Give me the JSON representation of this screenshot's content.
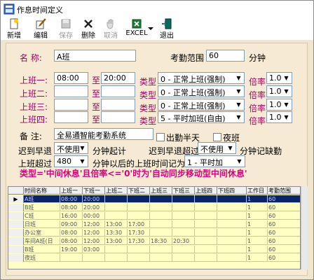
{
  "window": {
    "title": "作息时间定义"
  },
  "toolbar": {
    "new_label": "新增",
    "edit_label": "编辑",
    "save_label": "保存",
    "delete_label": "删除",
    "cancel_label": "取消",
    "excel_label": "EXCEL",
    "exit_label": "退出"
  },
  "form": {
    "name_label": "名  称:",
    "name_value": "A班",
    "range_label": "考勤范围",
    "range_value": "60",
    "range_unit": "分钟",
    "shift1_label": "上班一:",
    "shift2_label": "上班二:",
    "shift3_label": "上班三:",
    "shift4_label": "上班四:",
    "shift1_start": "08:00",
    "shift1_end": "20:00",
    "to_label": "至",
    "type_label": "类型",
    "rate_label": "倍率",
    "type1": "0 - 正常上班(强制)",
    "type2": "0 - 正常上班(强制)",
    "type3": "0 - 正常上班(强制)",
    "type4": "5 - 平时加班(自由)",
    "rate1": "1.0",
    "rate2": "1.0",
    "rate3": "1.0",
    "rate4": "1.0",
    "remark_label": "备  注:",
    "remark_value": "全易通智能考勤系统",
    "halfday_label": "出勤半天",
    "night_label": "夜班",
    "late_label": "迟到早退",
    "late_value": "不使用",
    "late_unit": "分钟起计",
    "late_over_label": "迟到早退超过",
    "late_over_value": "不使用",
    "late_over_unit": "分钟记缺勤",
    "overtime_label": "上班超过",
    "overtime_value": "480",
    "overtime_text": "分钟以后的上班时间记为",
    "overtime_type": "1 - 平时加",
    "warning": "类型='中间休息'且倍率<='0'时为'自动同步移动型中间休息'"
  },
  "grid": {
    "headers": [
      "时间名称",
      "上班一",
      "下班一",
      "上班二",
      "下班二",
      "上班三",
      "下班三",
      "上班四",
      "下班四",
      "工作日",
      "考勤范围"
    ],
    "rows": [
      [
        "A班",
        "08:00",
        "20:00",
        "",
        "",
        "",
        "",
        "",
        "",
        "1",
        "60"
      ],
      [
        "B班",
        "08:00",
        "20:00",
        "",
        "",
        "",
        "",
        "",
        "",
        "1",
        "60"
      ],
      [
        "C班",
        "16:00",
        "00:00",
        "",
        "",
        "",
        "",
        "",
        "",
        "1",
        "60"
      ],
      [
        "日班",
        "09:00",
        "12:00",
        "13:00",
        "17:00",
        "",
        "",
        "",
        "",
        "1",
        "60"
      ],
      [
        "办公室",
        "08:00",
        "12:00",
        "13:30",
        "17:30",
        "",
        "",
        "",
        "",
        "1",
        "60"
      ],
      [
        "车间A班(日",
        "08:00",
        "12:00",
        "13:00",
        "17:30",
        "18:30",
        "20:30",
        "",
        "",
        "1",
        "60"
      ],
      [
        "B班",
        "19:00",
        "03:00",
        "",
        "",
        "",
        "",
        "",
        "",
        "1",
        "60"
      ],
      [
        "夜班",
        "",
        "",
        "",
        "",
        "",
        "",
        "",
        "",
        "1",
        "60"
      ]
    ]
  }
}
